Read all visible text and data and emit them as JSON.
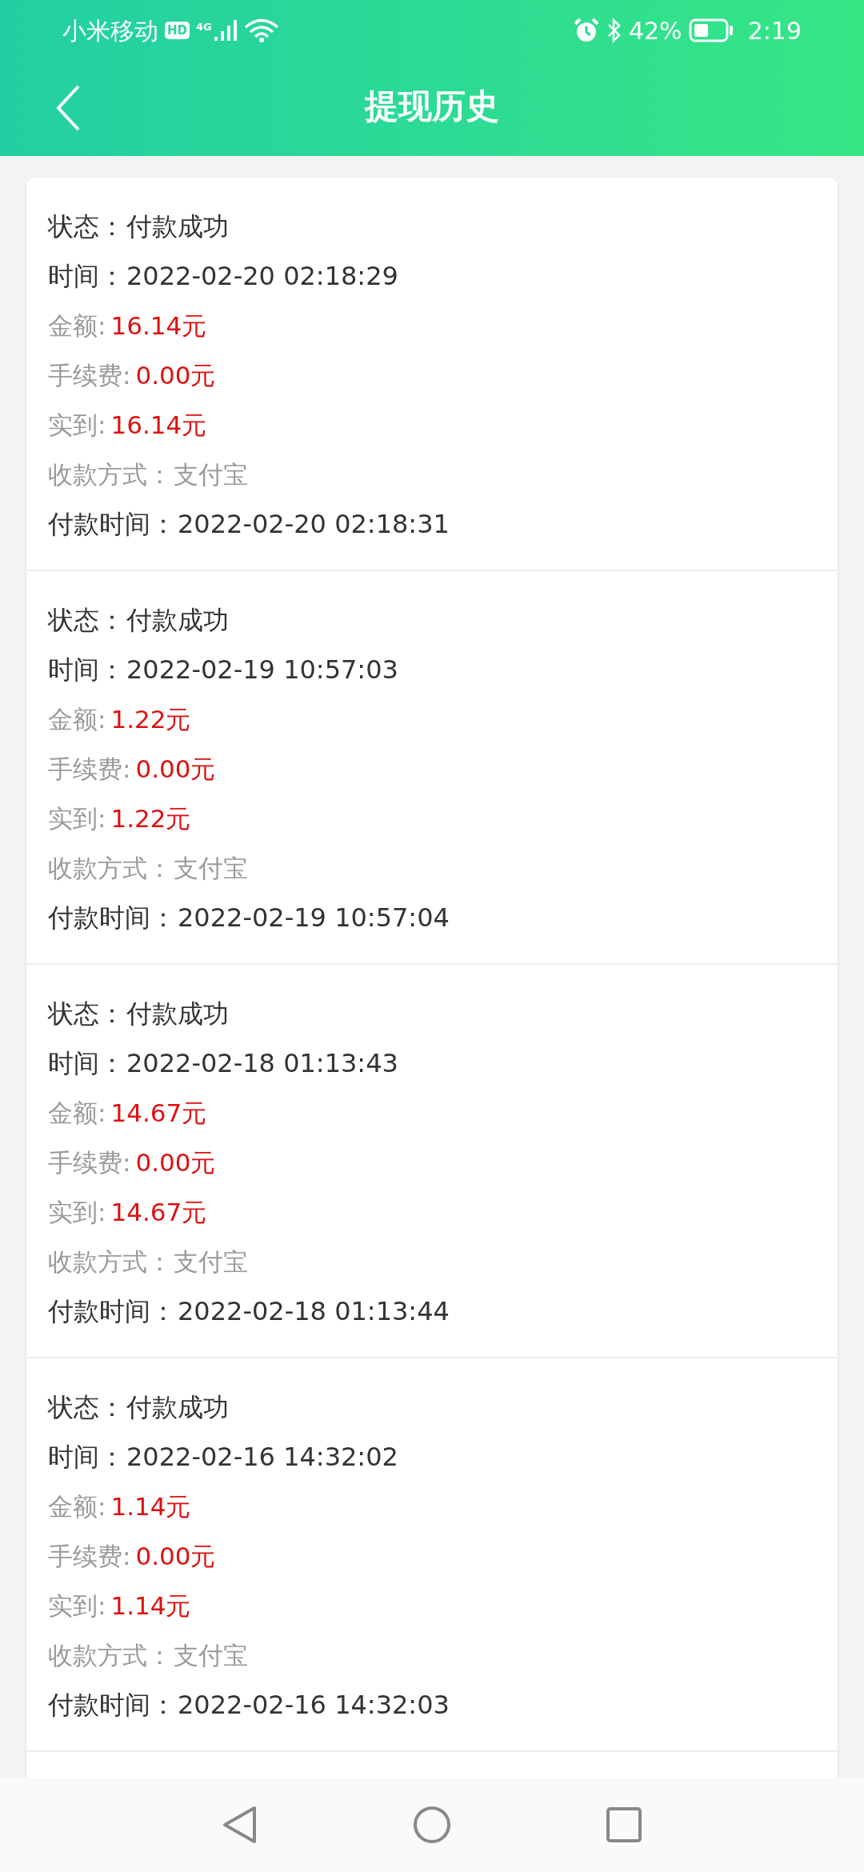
{
  "status_bar": {
    "carrier": "小米移动",
    "hd": "HD",
    "network": "4G",
    "battery": "42%",
    "time": "2:19"
  },
  "header": {
    "title": "提现历史"
  },
  "records": [
    {
      "rows": [
        {
          "kind": "plain",
          "label": "状态：",
          "value": "付款成功"
        },
        {
          "kind": "plain",
          "label": "时间：",
          "value": "2022-02-20 02:18:29"
        },
        {
          "kind": "money",
          "label": "金额:",
          "value": "16.14元"
        },
        {
          "kind": "money",
          "label": "手续费:",
          "value": "0.00元"
        },
        {
          "kind": "money",
          "label": "实到:",
          "value": "16.14元"
        },
        {
          "kind": "muted",
          "label": "收款方式：",
          "value": "支付宝"
        },
        {
          "kind": "plain",
          "label": "付款时间：",
          "value": "2022-02-20 02:18:31"
        }
      ]
    },
    {
      "rows": [
        {
          "kind": "plain",
          "label": "状态：",
          "value": "付款成功"
        },
        {
          "kind": "plain",
          "label": "时间：",
          "value": "2022-02-19 10:57:03"
        },
        {
          "kind": "money",
          "label": "金额:",
          "value": "1.22元"
        },
        {
          "kind": "money",
          "label": "手续费:",
          "value": "0.00元"
        },
        {
          "kind": "money",
          "label": "实到:",
          "value": "1.22元"
        },
        {
          "kind": "muted",
          "label": "收款方式：",
          "value": "支付宝"
        },
        {
          "kind": "plain",
          "label": "付款时间：",
          "value": "2022-02-19 10:57:04"
        }
      ]
    },
    {
      "rows": [
        {
          "kind": "plain",
          "label": "状态：",
          "value": "付款成功"
        },
        {
          "kind": "plain",
          "label": "时间：",
          "value": "2022-02-18 01:13:43"
        },
        {
          "kind": "money",
          "label": "金额:",
          "value": "14.67元"
        },
        {
          "kind": "money",
          "label": "手续费:",
          "value": "0.00元"
        },
        {
          "kind": "money",
          "label": "实到:",
          "value": "14.67元"
        },
        {
          "kind": "muted",
          "label": "收款方式：",
          "value": "支付宝"
        },
        {
          "kind": "plain",
          "label": "付款时间：",
          "value": "2022-02-18 01:13:44"
        }
      ]
    },
    {
      "rows": [
        {
          "kind": "plain",
          "label": "状态：",
          "value": "付款成功"
        },
        {
          "kind": "plain",
          "label": "时间：",
          "value": "2022-02-16 14:32:02"
        },
        {
          "kind": "money",
          "label": "金额:",
          "value": "1.14元"
        },
        {
          "kind": "money",
          "label": "手续费:",
          "value": "0.00元"
        },
        {
          "kind": "money",
          "label": "实到:",
          "value": "1.14元"
        },
        {
          "kind": "muted",
          "label": "收款方式：",
          "value": "支付宝"
        },
        {
          "kind": "plain",
          "label": "付款时间：",
          "value": "2022-02-16 14:32:03"
        }
      ]
    }
  ]
}
